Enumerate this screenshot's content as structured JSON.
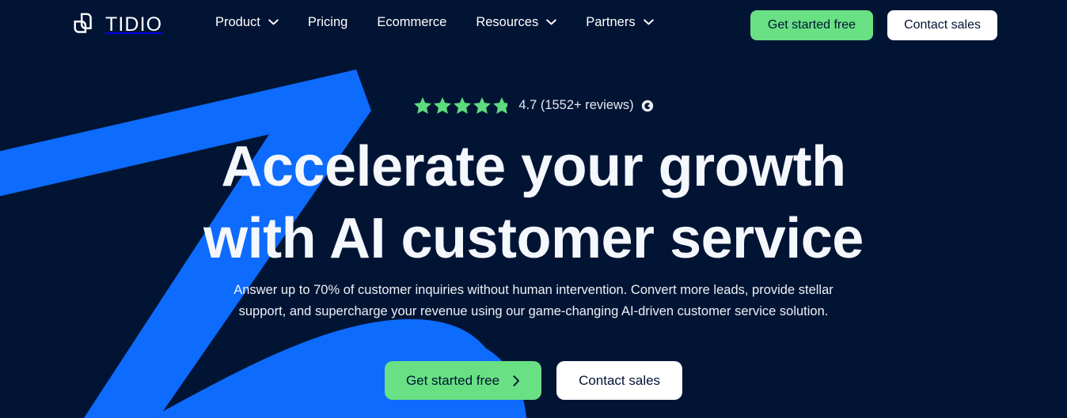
{
  "brand": {
    "name": "TIDIO",
    "logo_icon": "tidio-chat-bubble-logo",
    "colors": {
      "background": "#021434",
      "accent_blue": "#0D6BFD",
      "accent_green": "#68E083",
      "text_light": "#F4F7FB"
    }
  },
  "header": {
    "nav": [
      {
        "label": "Product",
        "has_dropdown": true,
        "icon": "chevron-down-icon"
      },
      {
        "label": "Pricing",
        "has_dropdown": false,
        "icon": ""
      },
      {
        "label": "Ecommerce",
        "has_dropdown": false,
        "icon": ""
      },
      {
        "label": "Resources",
        "has_dropdown": true,
        "icon": "chevron-down-icon"
      },
      {
        "label": "Partners",
        "has_dropdown": true,
        "icon": "chevron-down-icon"
      }
    ],
    "primary_cta": "Get started free",
    "secondary_cta": "Contact sales"
  },
  "hero": {
    "rating": {
      "stars_filled": 5,
      "score": "4.7",
      "reviews_text": "4.7 (1552+ reviews)",
      "badge_icon": "g2-badge-icon"
    },
    "headline_line1": "Accelerate your growth",
    "headline_line2": "with AI customer service",
    "subtitle": "Answer up to 70% of customer inquiries without human intervention. Convert more leads, provide stellar support, and supercharge your revenue using our game-changing AI-driven customer service solution.",
    "primary_cta": "Get started free",
    "primary_cta_icon": "chevron-right-icon",
    "secondary_cta": "Contact sales"
  }
}
